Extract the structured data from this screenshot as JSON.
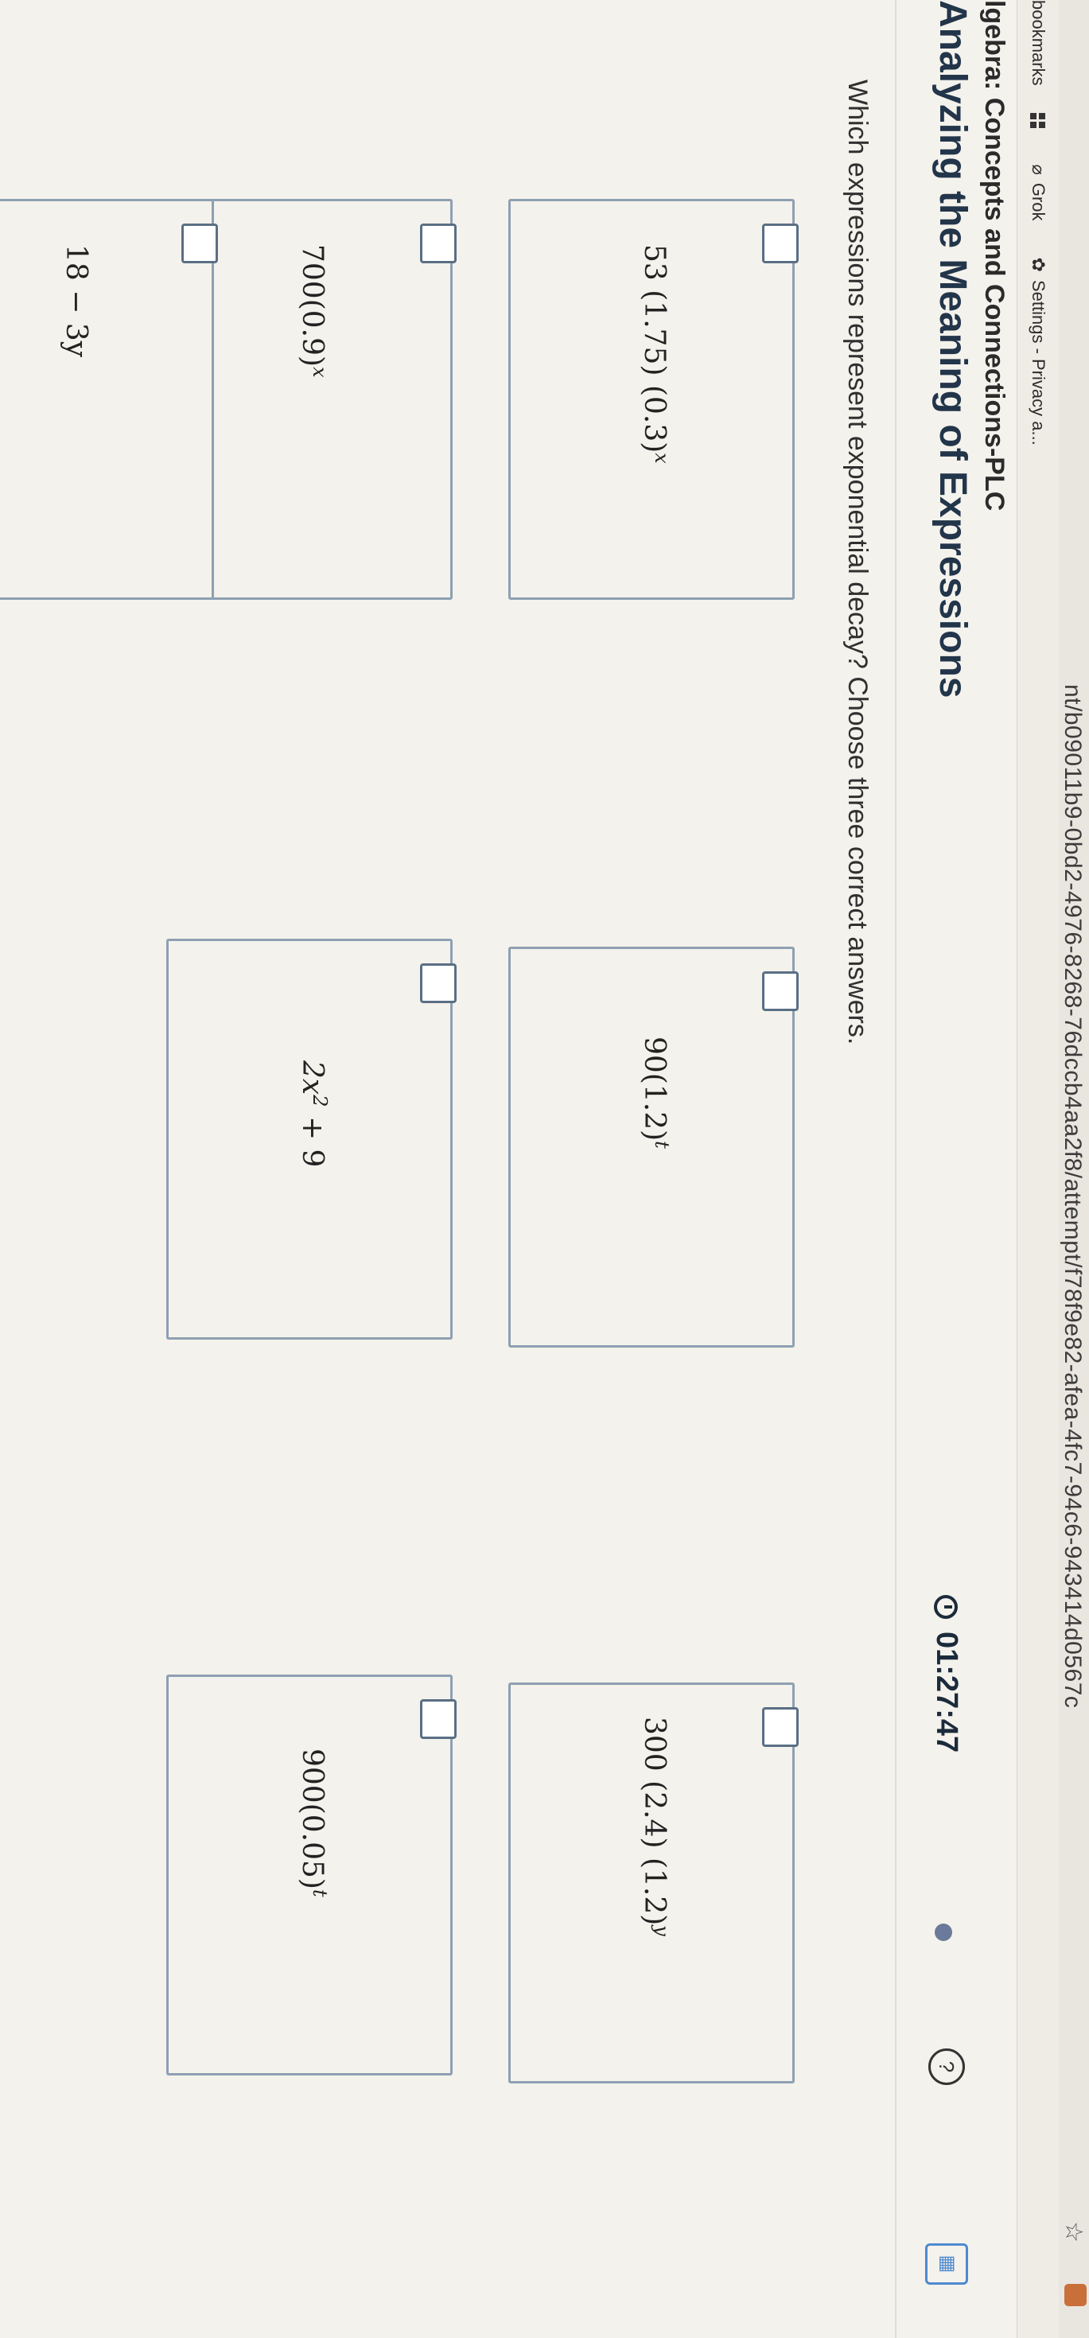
{
  "browser": {
    "url": "nt/b09011b9-0bd2-4976-8268-76dccb4aa2f8/attempt/f78f9e82-afea-4fc7-94c6-943414d0567c",
    "bookmarks_label": "bookmarks",
    "bookmarks": [
      {
        "label": "Grok",
        "icon": "slash-circle-icon"
      },
      {
        "label": "Settings - Privacy a...",
        "icon": "gear-icon"
      }
    ]
  },
  "header": {
    "course_title": "lgebra: Concepts and Connections-PLC",
    "page_title": "Analyzing the Meaning of Expressions",
    "timer": "01:27:47"
  },
  "question": {
    "prompt": "Which expressions represent exponential decay? Choose three correct answers."
  },
  "options": [
    {
      "base": "53 (1.75) (0.3)",
      "exp": "x",
      "checked": false
    },
    {
      "base": "90(1.2)",
      "exp": "t",
      "checked": false
    },
    {
      "base": "300 (2.4) (1.2)",
      "exp": "y",
      "checked": false
    },
    {
      "base": "700(0.9)",
      "exp": "x",
      "checked": false
    },
    {
      "base": "2x",
      "exp": "2",
      "tail": " + 9",
      "checked": false
    },
    {
      "base": "900(0.05)",
      "exp": "t",
      "checked": false
    },
    {
      "base": "18 − 3y",
      "exp": "",
      "checked": false
    }
  ]
}
